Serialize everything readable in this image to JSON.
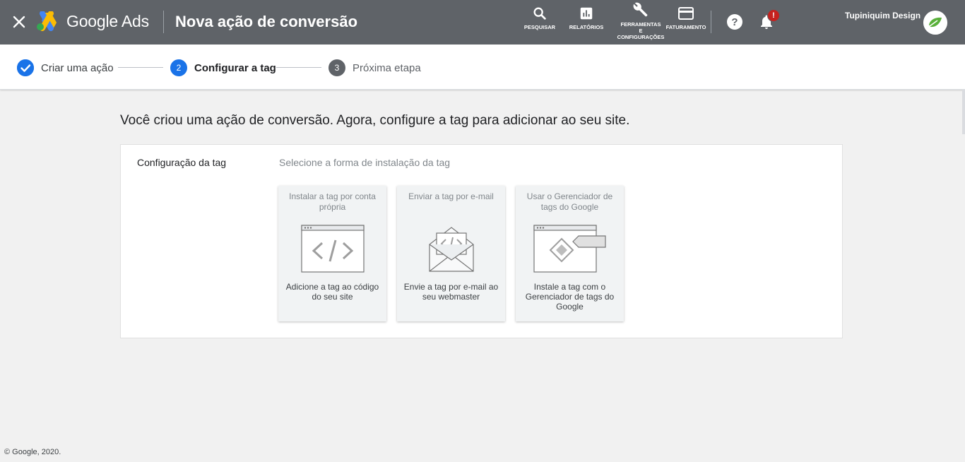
{
  "header": {
    "brand": "Google Ads",
    "title": "Nova ação de conversão",
    "tools": {
      "search": "PESQUISAR",
      "reports": "RELATÓRIOS",
      "tools_line1": "FERRAMENTAS",
      "tools_line2": "E",
      "tools_line3": "CONFIGURAÇÕES",
      "billing": "FATURAMENTO"
    },
    "notification_badge": "!",
    "account_name": "Tupiniquim Design"
  },
  "stepper": {
    "steps": [
      {
        "number": "1",
        "label": "Criar uma ação",
        "state": "done"
      },
      {
        "number": "2",
        "label": "Configurar a tag",
        "state": "current"
      },
      {
        "number": "3",
        "label": "Próxima etapa",
        "state": "pending"
      }
    ]
  },
  "main": {
    "headline": "Você criou uma ação de conversão. Agora, configure a tag para adicionar ao seu site.",
    "panel": {
      "label": "Configuração da tag",
      "subtitle": "Selecione a forma de instalação da tag",
      "cards": [
        {
          "title": "Instalar a tag por conta própria",
          "description": "Adicione a tag ao código do seu site",
          "icon": "code-window-icon"
        },
        {
          "title": "Enviar a tag por e-mail",
          "description": "Envie a tag por e-mail ao seu webmaster",
          "icon": "email-code-icon"
        },
        {
          "title": "Usar o Gerenciador de tags do Google",
          "description": "Instale a tag com o Gerenciador de tags do Google",
          "icon": "tag-manager-icon"
        }
      ]
    }
  },
  "footer": {
    "copyright": "© Google, 2020."
  },
  "colors": {
    "topbar": "#5f6368",
    "accent": "#1a73e8",
    "badge": "#c5221f",
    "background": "#f1f1f1"
  }
}
